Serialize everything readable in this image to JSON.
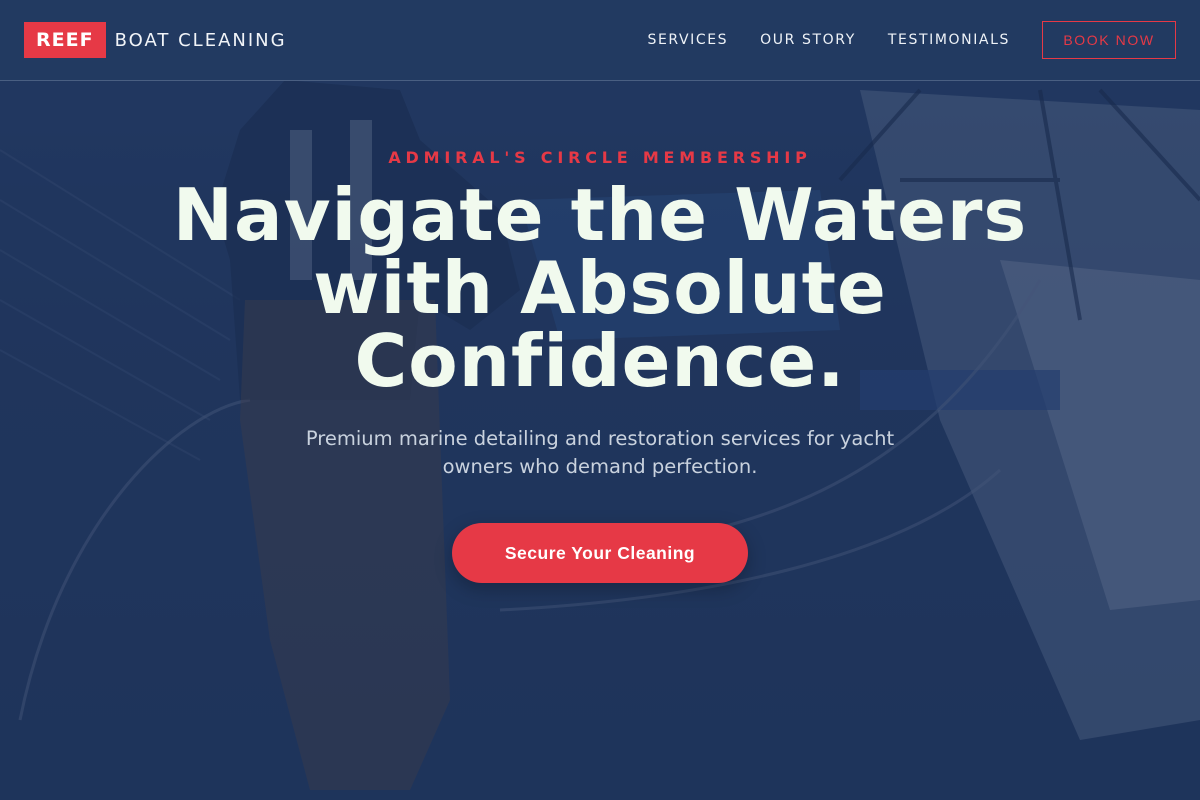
{
  "brand": {
    "badge": "REEF",
    "name": "BOAT CLEANING"
  },
  "nav": {
    "links": [
      "SERVICES",
      "OUR STORY",
      "TESTIMONIALS"
    ],
    "cta": "BOOK NOW"
  },
  "hero": {
    "eyebrow": "ADMIRAL'S CIRCLE MEMBERSHIP",
    "headline": "Navigate the Waters with Absolute Confidence.",
    "subtext": "Premium marine detailing and restoration services for yacht owners who demand perfection.",
    "cta": "Secure Your Cleaning"
  },
  "colors": {
    "accent": "#e63946",
    "navy": "#1d3358",
    "headline": "#f1faee"
  }
}
